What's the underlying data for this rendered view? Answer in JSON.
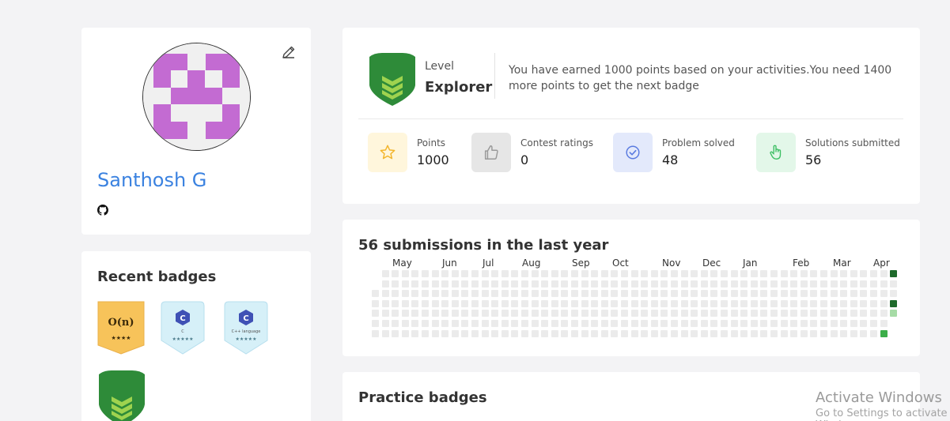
{
  "profile": {
    "name": "Santhosh G"
  },
  "recent_badges": {
    "title": "Recent badges",
    "items": [
      {
        "name": "big-o-badge",
        "text": "O(n)",
        "stars": "★★★★"
      },
      {
        "name": "c-badge",
        "text": "C",
        "sub": "C",
        "stars": "★★★★★"
      },
      {
        "name": "cpp-badge",
        "text": "C",
        "sub": "C++ language",
        "stars": "★★★★★"
      },
      {
        "name": "explorer-badge"
      }
    ]
  },
  "level": {
    "label": "Level",
    "value": "Explorer",
    "description": "You have earned 1000 points based on your activities.You need 1400 more points to get the next badge"
  },
  "stats": [
    {
      "label": "Points",
      "value": "1000",
      "icon": "star-icon",
      "bg": "#fff6dc",
      "color": "#f3b52b"
    },
    {
      "label": "Contest ratings",
      "value": "0",
      "icon": "thumbs-up-icon",
      "bg": "#e6e6e6",
      "color": "#9a9a9a"
    },
    {
      "label": "Problem solved",
      "value": "48",
      "icon": "check-circle-icon",
      "bg": "#e3e9fb",
      "color": "#5a7be0"
    },
    {
      "label": "Solutions submitted",
      "value": "56",
      "icon": "pointer-hand-icon",
      "bg": "#e3f7e9",
      "color": "#3cbf63"
    }
  ],
  "heatmap": {
    "title": "56 submissions in the last year",
    "months": [
      "May",
      "Jun",
      "Jul",
      "Aug",
      "Sep",
      "Oct",
      "Nov",
      "Dec",
      "Jan",
      "Feb",
      "Mar",
      "Apr"
    ],
    "colors": {
      "empty": "#ebebeb",
      "dark": "#1e6a2b",
      "medium": "#3cae49",
      "light": "#a6dba6"
    },
    "active": [
      {
        "week": 52,
        "day": 0,
        "level": "dark"
      },
      {
        "week": 52,
        "day": 3,
        "level": "dark"
      },
      {
        "week": 52,
        "day": 4,
        "level": "light"
      },
      {
        "week": 51,
        "day": 6,
        "level": "medium"
      }
    ]
  },
  "practice": {
    "title": "Practice badges"
  },
  "watermark": {
    "title": "Activate Windows",
    "subtitle": "Go to Settings to activate Windows."
  }
}
